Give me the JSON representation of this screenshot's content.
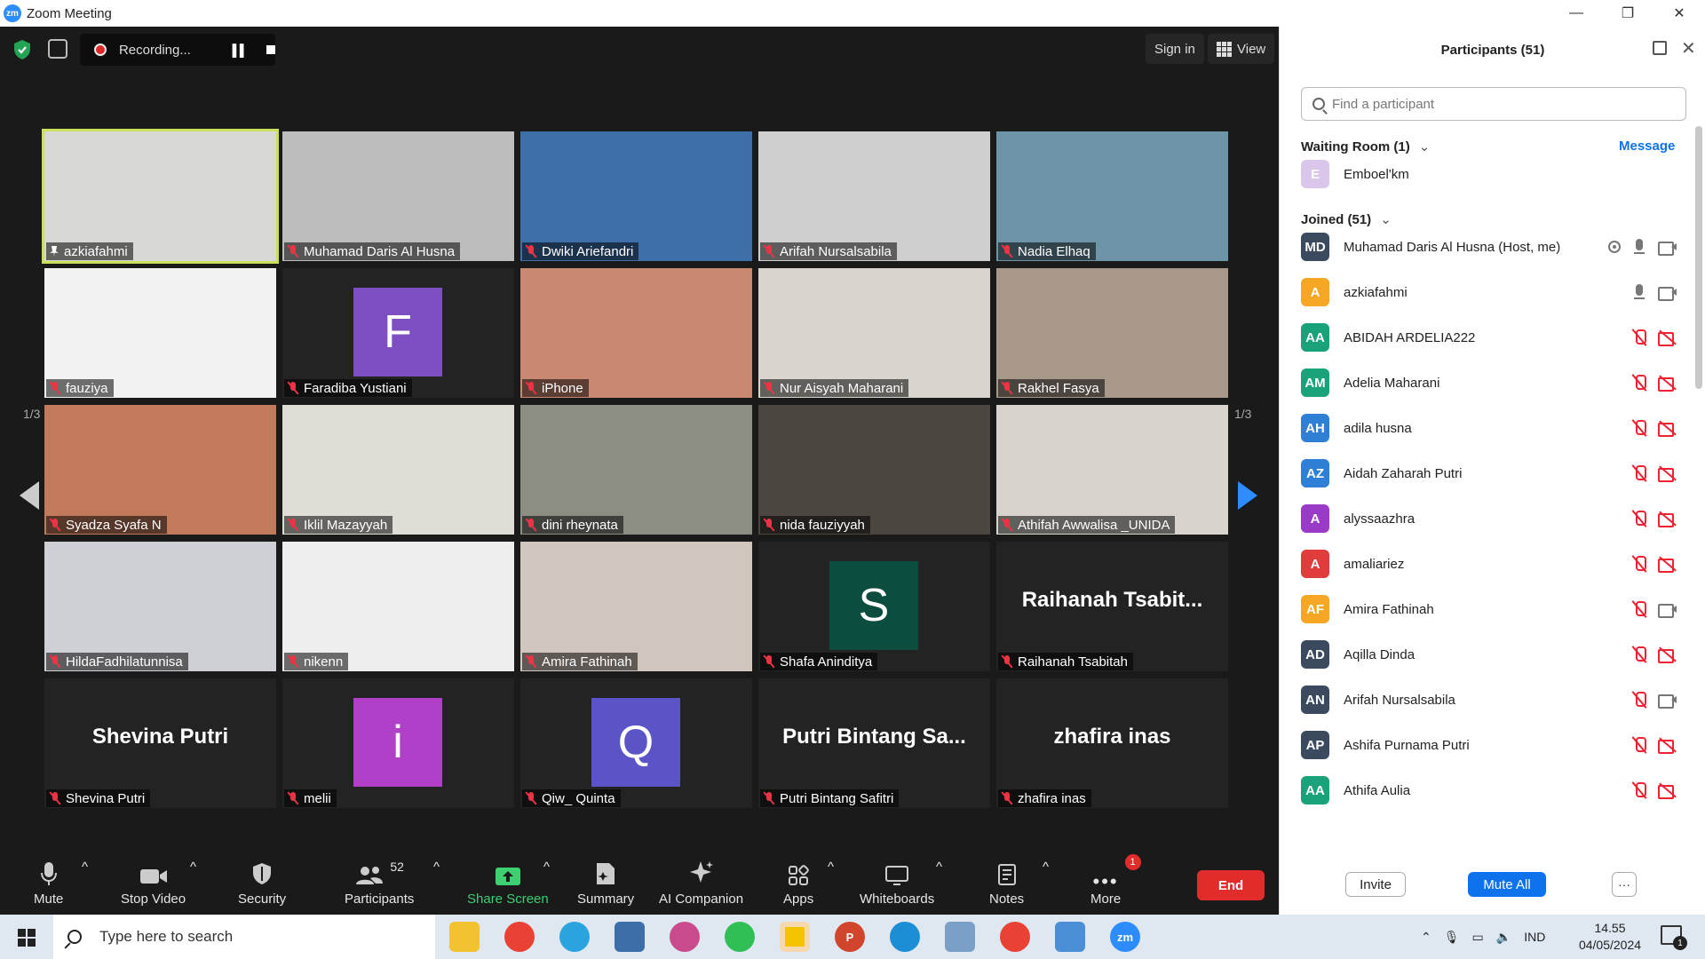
{
  "window": {
    "title": "Zoom Meeting",
    "logo_text": "zm"
  },
  "topbar": {
    "recording_label": "Recording...",
    "signin_label": "Sign in",
    "view_label": "View"
  },
  "pager": {
    "left": "1/3",
    "right": "1/3"
  },
  "tiles": [
    {
      "name": "azkiafahmi",
      "type": "photo",
      "color": "#d8d8d6",
      "active": true
    },
    {
      "name": "Muhamad Daris Al Husna",
      "type": "photo",
      "color": "#bdbdbd"
    },
    {
      "name": "Dwiki Ariefandri",
      "type": "photo",
      "color": "#3f6fa8"
    },
    {
      "name": "Arifah Nursalsabila",
      "type": "photo",
      "color": "#cfcfcf"
    },
    {
      "name": "Nadia Elhaq",
      "type": "photo",
      "color": "#6d94a7"
    },
    {
      "name": "fauziya",
      "type": "photo",
      "color": "#f2f2f2"
    },
    {
      "name": "Faradiba Yustiani",
      "type": "avatar",
      "letter": "F",
      "color": "#7e4fc3"
    },
    {
      "name": "iPhone",
      "type": "photo",
      "color": "#c98872"
    },
    {
      "name": "Nur Aisyah Maharani",
      "type": "photo",
      "color": "#d9d4cd"
    },
    {
      "name": "Rakhel Fasya",
      "type": "photo",
      "color": "#a89889"
    },
    {
      "name": "Syadza Syafa N",
      "type": "photo",
      "color": "#c27a5d"
    },
    {
      "name": "Iklil Mazayyah",
      "type": "photo",
      "color": "#e0dcd6"
    },
    {
      "name": "dini rheynata",
      "type": "photo",
      "color": "#8c8e84"
    },
    {
      "name": "nida fauziyyah",
      "type": "photo",
      "color": "#4c4640"
    },
    {
      "name": "Athifah Awwalisa _UNIDA",
      "type": "photo",
      "color": "#d8d3cc"
    },
    {
      "name": "HildaFadhilatunnisa",
      "type": "photo",
      "color": "#cfcfd6"
    },
    {
      "name": "nikenn",
      "type": "photo",
      "color": "#eeeeee"
    },
    {
      "name": "Amira Fathinah",
      "type": "photo",
      "color": "#d1c6bd"
    },
    {
      "name": "Shafa Aninditya",
      "type": "avatar",
      "letter": "S",
      "color": "#0c4d3f"
    },
    {
      "name": "Raihanah Tsabitah",
      "type": "text",
      "bigname": "Raihanah  Tsabit..."
    },
    {
      "name": "Shevina Putri",
      "type": "text",
      "bigname": "Shevina Putri"
    },
    {
      "name": "melii",
      "type": "avatar",
      "letter": "i",
      "color": "#b040c8"
    },
    {
      "name": "Qiw_ Quinta",
      "type": "avatar",
      "letter": "Q",
      "color": "#5a54c8"
    },
    {
      "name": "Putri Bintang Safitri",
      "type": "text",
      "bigname": "Putri Bintang Sa..."
    },
    {
      "name": "zhafira inas",
      "type": "text",
      "bigname": "zhafira inas"
    }
  ],
  "toolbar": {
    "mute": "Mute",
    "stop_video": "Stop Video",
    "security": "Security",
    "participants": "Participants",
    "participants_count": "52",
    "share_screen": "Share Screen",
    "summary": "Summary",
    "ai_companion": "AI Companion",
    "apps": "Apps",
    "whiteboards": "Whiteboards",
    "notes": "Notes",
    "more": "More",
    "more_badge": "1",
    "end": "End"
  },
  "panel": {
    "title": "Participants (51)",
    "search_placeholder": "Find a participant",
    "waiting_room": "Waiting Room (1)",
    "message": "Message",
    "waiting": [
      {
        "initials": "E",
        "name": "Emboel'km",
        "color": "#d9c6ea"
      }
    ],
    "joined": "Joined (51)",
    "participants": [
      {
        "initials": "MD",
        "name": "Muhamad Daris Al Husna (Host, me)",
        "color": "#3b4a5e",
        "status": "host"
      },
      {
        "initials": "A",
        "name": "azkiafahmi",
        "color": "#f5a623",
        "status": "on"
      },
      {
        "initials": "AA",
        "name": "ABIDAH ARDELIA222",
        "color": "#1aa37a",
        "status": "off"
      },
      {
        "initials": "AM",
        "name": "Adelia Maharani",
        "color": "#1aa37a",
        "status": "off"
      },
      {
        "initials": "AH",
        "name": "adila husna",
        "color": "#2f7fd6",
        "status": "off"
      },
      {
        "initials": "AZ",
        "name": "Aidah Zaharah Putri",
        "color": "#2f7fd6",
        "status": "off"
      },
      {
        "initials": "A",
        "name": "alyssaazhra",
        "color": "#9a3bc7",
        "status": "off"
      },
      {
        "initials": "A",
        "name": "amaliariez",
        "color": "#e03c3c",
        "status": "off"
      },
      {
        "initials": "AF",
        "name": "Amira Fathinah",
        "color": "#f5a623",
        "status": "camon"
      },
      {
        "initials": "AD",
        "name": "Aqilla Dinda",
        "color": "#3b4a5e",
        "status": "off"
      },
      {
        "initials": "AN",
        "name": "Arifah Nursalsabila",
        "color": "#3b4a5e",
        "status": "camon"
      },
      {
        "initials": "AP",
        "name": "Ashifa Purnama Putri",
        "color": "#3b4a5e",
        "status": "off"
      },
      {
        "initials": "AA",
        "name": "Athifa Aulia",
        "color": "#1aa37a",
        "status": "off"
      }
    ],
    "invite": "Invite",
    "mute_all": "Mute All",
    "more": "···"
  },
  "taskbar": {
    "search_placeholder": "Type here to search",
    "lang": "IND",
    "time": "14.55",
    "date": "04/05/2024",
    "notif_count": "1"
  }
}
